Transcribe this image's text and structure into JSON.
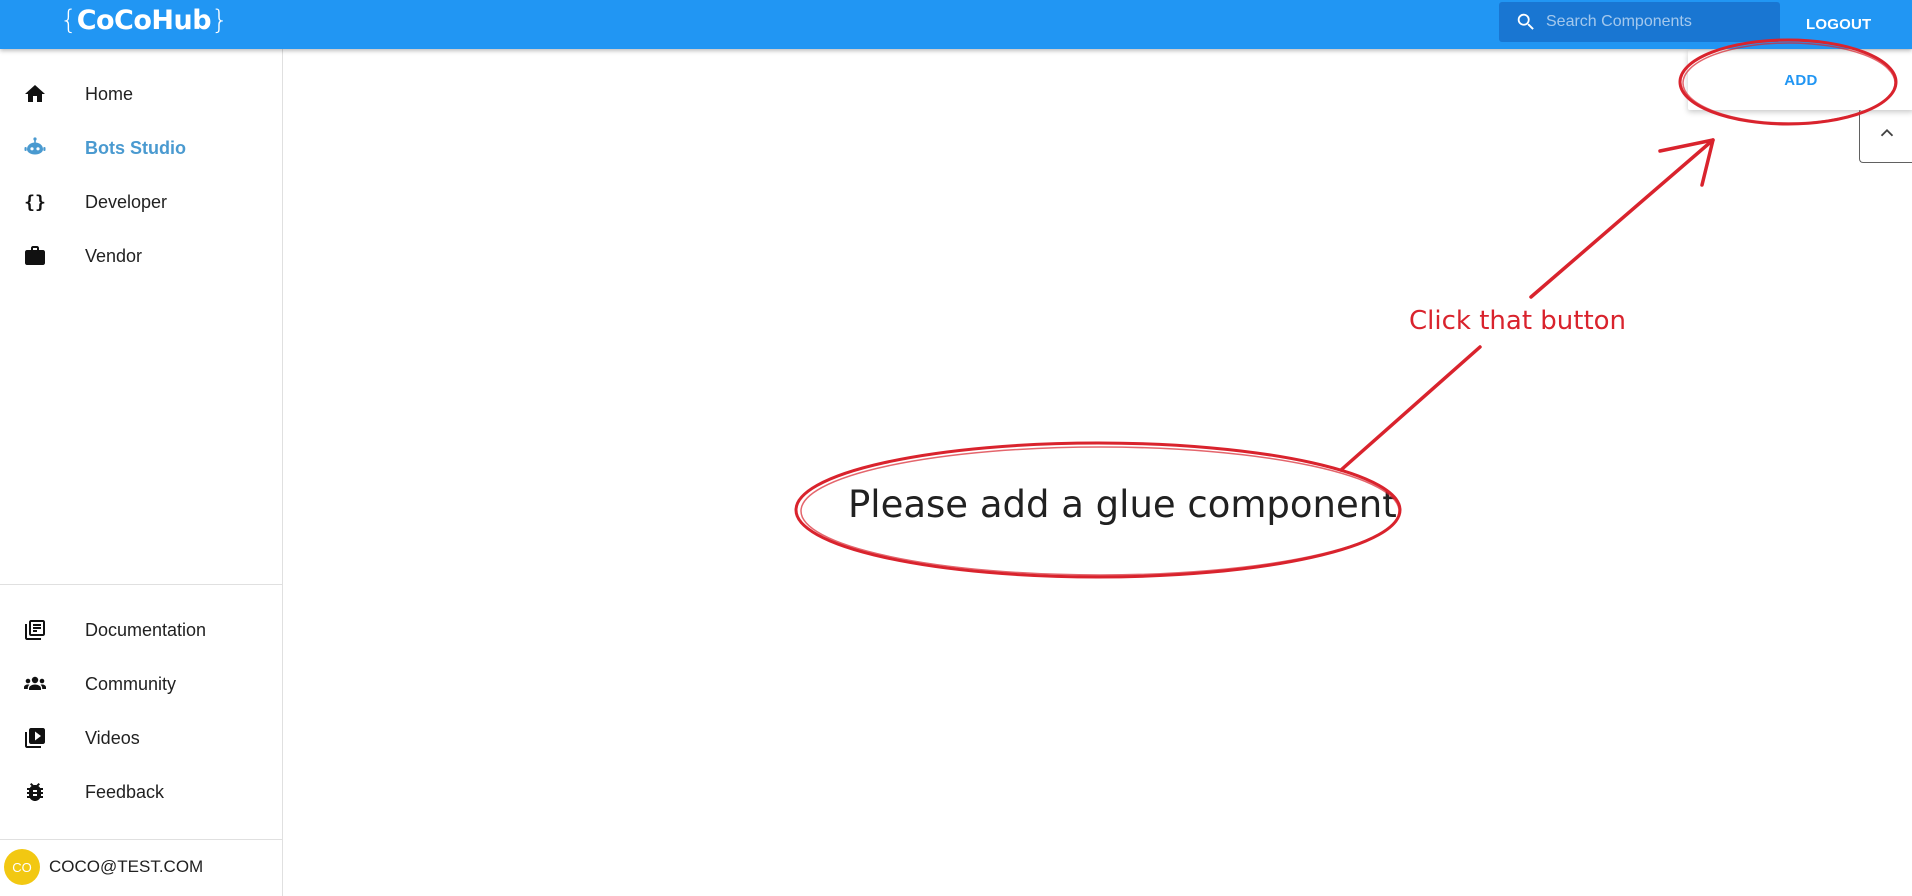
{
  "app": {
    "logo_open_brace": "{",
    "logo_name": "CoCoHub",
    "logo_close_brace": "}"
  },
  "header": {
    "search_placeholder": "Search Components",
    "search_icon": "search-icon",
    "logout_label": "LOGOUT"
  },
  "sidebar": {
    "primary_items": [
      {
        "label": "Home",
        "icon": "home-icon",
        "active": false
      },
      {
        "label": "Bots Studio",
        "icon": "robot-icon",
        "active": true
      },
      {
        "label": "Developer",
        "icon": "code-braces-icon",
        "active": false
      },
      {
        "label": "Vendor",
        "icon": "briefcase-icon",
        "active": false
      }
    ],
    "secondary_items": [
      {
        "label": "Documentation",
        "icon": "library-books-icon"
      },
      {
        "label": "Community",
        "icon": "people-icon"
      },
      {
        "label": "Videos",
        "icon": "video-library-icon"
      },
      {
        "label": "Feedback",
        "icon": "bug-icon"
      }
    ],
    "user": {
      "avatar_initials": "CO",
      "email": "COCO@TEST.COM"
    }
  },
  "main": {
    "add_label": "ADD",
    "collapse_icon": "chevron-up-icon",
    "empty_message": "Please add a glue component"
  },
  "annotation": {
    "callout_text": "Click that button"
  },
  "colors": {
    "appbar": "#2196f3",
    "search_bg": "#1976d2",
    "active_nav": "#4a9ad0",
    "avatar": "#f2c812",
    "annotation": "#d9232d"
  }
}
